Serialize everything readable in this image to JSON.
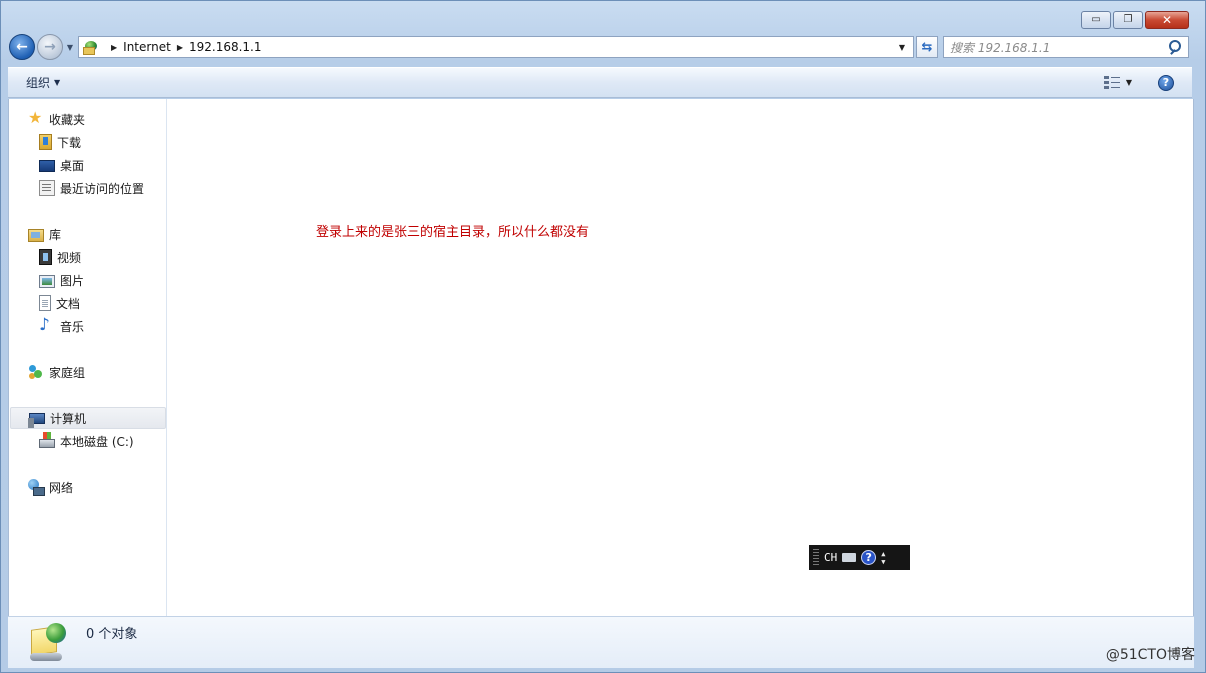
{
  "window": {
    "caption_buttons": {
      "minimize": "▭",
      "maximize": "❐",
      "close": "✕"
    }
  },
  "nav": {
    "breadcrumb": [
      "Internet",
      "192.168.1.1"
    ],
    "search_placeholder": "搜索 192.168.1.1"
  },
  "toolbar": {
    "organize_label": "组织"
  },
  "sidebar": {
    "favorites": {
      "label": "收藏夹",
      "items": [
        {
          "label": "下载",
          "icon": "download-icon"
        },
        {
          "label": "桌面",
          "icon": "desktop-icon"
        },
        {
          "label": "最近访问的位置",
          "icon": "recent-places-icon"
        }
      ]
    },
    "libraries": {
      "label": "库",
      "items": [
        {
          "label": "视频",
          "icon": "video-icon"
        },
        {
          "label": "图片",
          "icon": "pictures-icon"
        },
        {
          "label": "文档",
          "icon": "documents-icon"
        },
        {
          "label": "音乐",
          "icon": "music-icon"
        }
      ]
    },
    "homegroup": {
      "label": "家庭组"
    },
    "computer": {
      "label": "计算机",
      "items": [
        {
          "label": "本地磁盘 (C:)",
          "icon": "local-disk-icon"
        }
      ]
    },
    "network": {
      "label": "网络"
    }
  },
  "content": {
    "annotation": "登录上来的是张三的宿主目录，所以什么都没有"
  },
  "ime_toolbar": {
    "language": "CH",
    "help": "?"
  },
  "status": {
    "item_count": "0 个对象"
  },
  "watermark": "@51CTO博客",
  "colors": {
    "annotation": "#c00000",
    "window_frame": "#b9d1ea"
  }
}
